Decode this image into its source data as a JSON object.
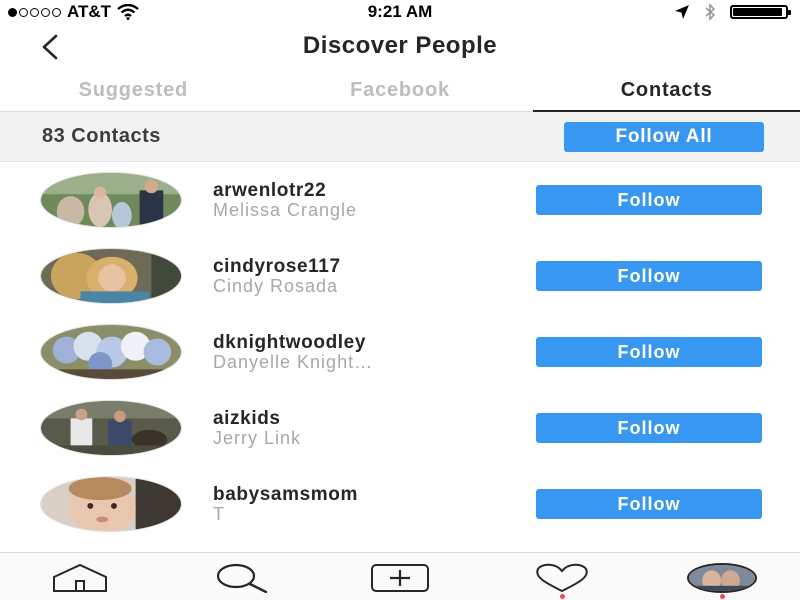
{
  "status_bar": {
    "carrier": "AT&T",
    "time": "9:21 AM",
    "battery_level": 0.95
  },
  "nav": {
    "title": "Discover People"
  },
  "tabs": [
    {
      "label": "Suggested",
      "active": false
    },
    {
      "label": "Facebook",
      "active": false
    },
    {
      "label": "Contacts",
      "active": true
    }
  ],
  "contacts_bar": {
    "count_label": "83 Contacts",
    "follow_all_label": "Follow All"
  },
  "people": [
    {
      "username": "arwenlotr22",
      "name": "Melissa Crangle",
      "follow_label": "Follow"
    },
    {
      "username": "cindyrose117",
      "name": "Cindy Rosada",
      "follow_label": "Follow"
    },
    {
      "username": "dknightwoodley",
      "name": "Danyelle Knight…",
      "follow_label": "Follow"
    },
    {
      "username": "aizkids",
      "name": "Jerry Link",
      "follow_label": "Follow"
    },
    {
      "username": "babysamsmom",
      "name": "T",
      "follow_label": "Follow"
    }
  ],
  "bottom_bar": {
    "icons": [
      "home-icon",
      "search-icon",
      "add-post-icon",
      "activity-heart-icon",
      "profile-avatar"
    ]
  },
  "colors": {
    "accent": "#3897f0",
    "notification_dot": "#ed4956",
    "header_band": "#f2f2f2"
  }
}
